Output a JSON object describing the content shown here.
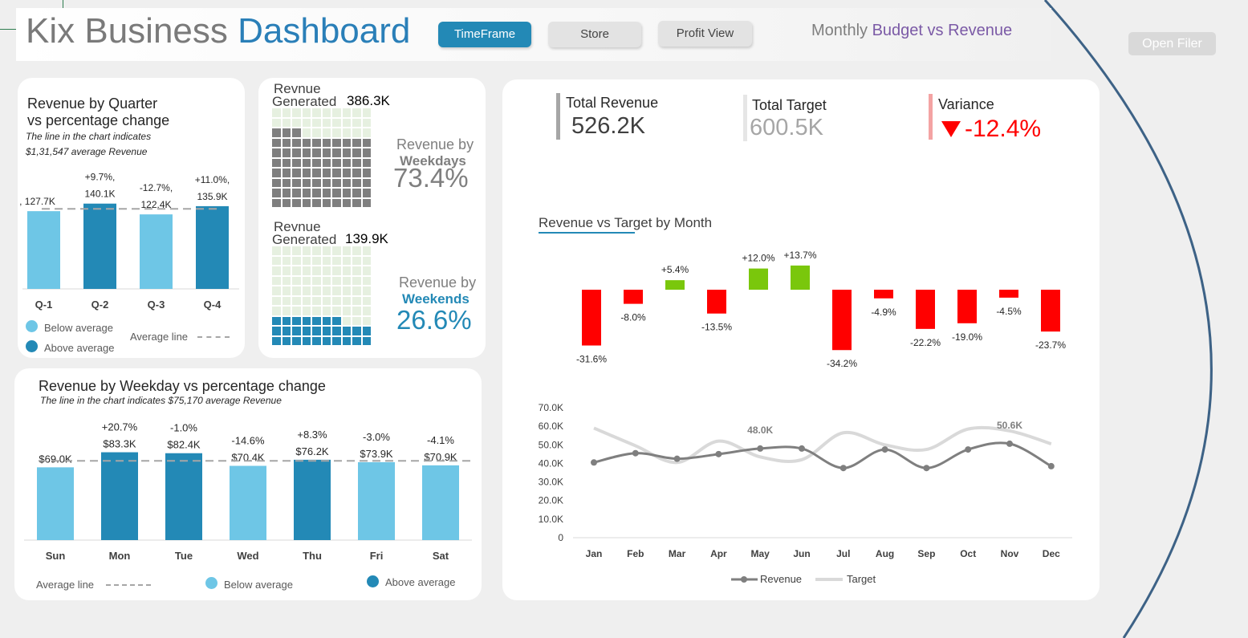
{
  "header": {
    "title_part1": "Kix Business ",
    "title_part2": "Dashboard",
    "tabs": [
      {
        "label": "TimeFrame",
        "active": true
      },
      {
        "label": "Store",
        "active": false
      },
      {
        "label": "Profit View",
        "active": false
      }
    ],
    "budget_title_part1": "Monthly ",
    "budget_title_part2": "Budget vs Revenue",
    "open_filer": "Open Filer"
  },
  "colors": {
    "above_average": "#2389b6",
    "below_average": "#6ec6e6",
    "positive": "#7ac70c",
    "negative": "#ff0000",
    "revenue_line": "#7f7f7f",
    "target_line": "#d9d9d9"
  },
  "quarter_card": {
    "title_line1": "Revenue by Quarter",
    "title_line2": "vs percentage change",
    "subtitle_line1": "The line in the chart indicates",
    "subtitle_line2": "$1,31,547 average Revenue",
    "legend_below": "Below average",
    "legend_above": "Above average",
    "legend_avg": "Average line"
  },
  "waffle_card": {
    "weekdays": {
      "label_line1": "Revnue",
      "label_line2": "Generated",
      "value": "386.3K",
      "side_line1": "Revenue by",
      "side_line2": "Weekdays",
      "percent": "73.4%",
      "share": 0.734
    },
    "weekends": {
      "label_line1": "Revnue",
      "label_line2": "Generated",
      "value": "139.9K",
      "side_line1": "Revenue by",
      "side_line2": "Weekends",
      "percent": "26.6%",
      "share": 0.266
    }
  },
  "weekday_card": {
    "title": "Revenue by Weekday vs percentage change",
    "subtitle": "The line in the chart indicates $75,170 average Revenue",
    "legend_avg": "Average line",
    "legend_below": "Below average",
    "legend_above": "Above average"
  },
  "kpis": {
    "total_revenue_label": "Total Revenue",
    "total_revenue_value": "526.2K",
    "total_target_label": "Total Target",
    "total_target_value": "600.5K",
    "variance_label": "Variance",
    "variance_value": "-12.4%",
    "variance_icon": "down-triangle-icon"
  },
  "monthly_card": {
    "title": "Revenue vs Target by Month"
  },
  "chart_data": [
    {
      "type": "bar",
      "title": "Revenue by Quarter vs percentage change",
      "categories": [
        "Q-1",
        "Q-2",
        "Q-3",
        "Q-4"
      ],
      "values": [
        127.7,
        140.1,
        122.4,
        135.9
      ],
      "labels": [
        ", 127.7K",
        "+9.7%,\n140.1K",
        "-12.7%,\n122.4K",
        "+11.0%,\n135.9K"
      ],
      "above_average": [
        false,
        true,
        false,
        true
      ],
      "average": 131.5,
      "ylim": [
        0,
        145
      ],
      "unit": "K"
    },
    {
      "type": "bar",
      "title": "Revenue by Weekday vs percentage change",
      "categories": [
        "Sun",
        "Mon",
        "Tue",
        "Wed",
        "Thu",
        "Fri",
        "Sat"
      ],
      "values": [
        69.0,
        83.3,
        82.4,
        70.4,
        76.2,
        73.9,
        70.9
      ],
      "pct_labels": [
        "",
        "+20.7%",
        "-1.0%",
        "-14.6%",
        "+8.3%",
        "-3.0%",
        "-4.1%"
      ],
      "value_labels": [
        "$69.0K",
        "$83.3K",
        "$82.4K",
        "$70.4K",
        "$76.2K",
        "$73.9K",
        "$70.9K"
      ],
      "above_average": [
        false,
        true,
        true,
        false,
        true,
        false,
        false
      ],
      "average": 75.2,
      "ylim": [
        0,
        86
      ]
    },
    {
      "type": "bar",
      "title": "Revenue vs Target by Month (variance)",
      "categories": [
        "Jan",
        "Feb",
        "Mar",
        "Apr",
        "May",
        "Jun",
        "Jul",
        "Aug",
        "Sep",
        "Oct",
        "Nov",
        "Dec"
      ],
      "values": [
        -31.6,
        -8.0,
        5.4,
        -13.5,
        12.0,
        13.7,
        -34.2,
        -4.9,
        -22.2,
        -19.0,
        -4.5,
        -23.7
      ],
      "labels": [
        "-31.6%",
        "-8.0%",
        "+5.4%",
        "-13.5%",
        "+12.0%",
        "+13.7%",
        "-34.2%",
        "-4.9%",
        "-22.2%",
        "-19.0%",
        "-4.5%",
        "-23.7%"
      ],
      "ylim": [
        -36,
        16
      ]
    },
    {
      "type": "line",
      "title": "",
      "categories": [
        "Jan",
        "Feb",
        "Mar",
        "Apr",
        "May",
        "Jun",
        "Jul",
        "Aug",
        "Sep",
        "Oct",
        "Nov",
        "Dec"
      ],
      "series": [
        {
          "name": "Revenue",
          "values": [
            40.5,
            45.5,
            42.5,
            45.0,
            48.0,
            48.0,
            37.5,
            47.5,
            37.5,
            47.5,
            50.6,
            38.5
          ]
        },
        {
          "name": "Target",
          "values": [
            59.0,
            49.5,
            40.5,
            52.0,
            43.5,
            42.0,
            56.5,
            50.0,
            47.5,
            58.5,
            57.5,
            50.5
          ]
        }
      ],
      "point_labels": {
        "May": "48.0K",
        "Nov": "50.6K"
      },
      "yticks": [
        "0",
        "10.0K",
        "20.0K",
        "30.0K",
        "40.0K",
        "50.0K",
        "60.0K",
        "70.0K"
      ],
      "ylim": [
        0,
        70
      ],
      "legend": "bottom"
    }
  ]
}
